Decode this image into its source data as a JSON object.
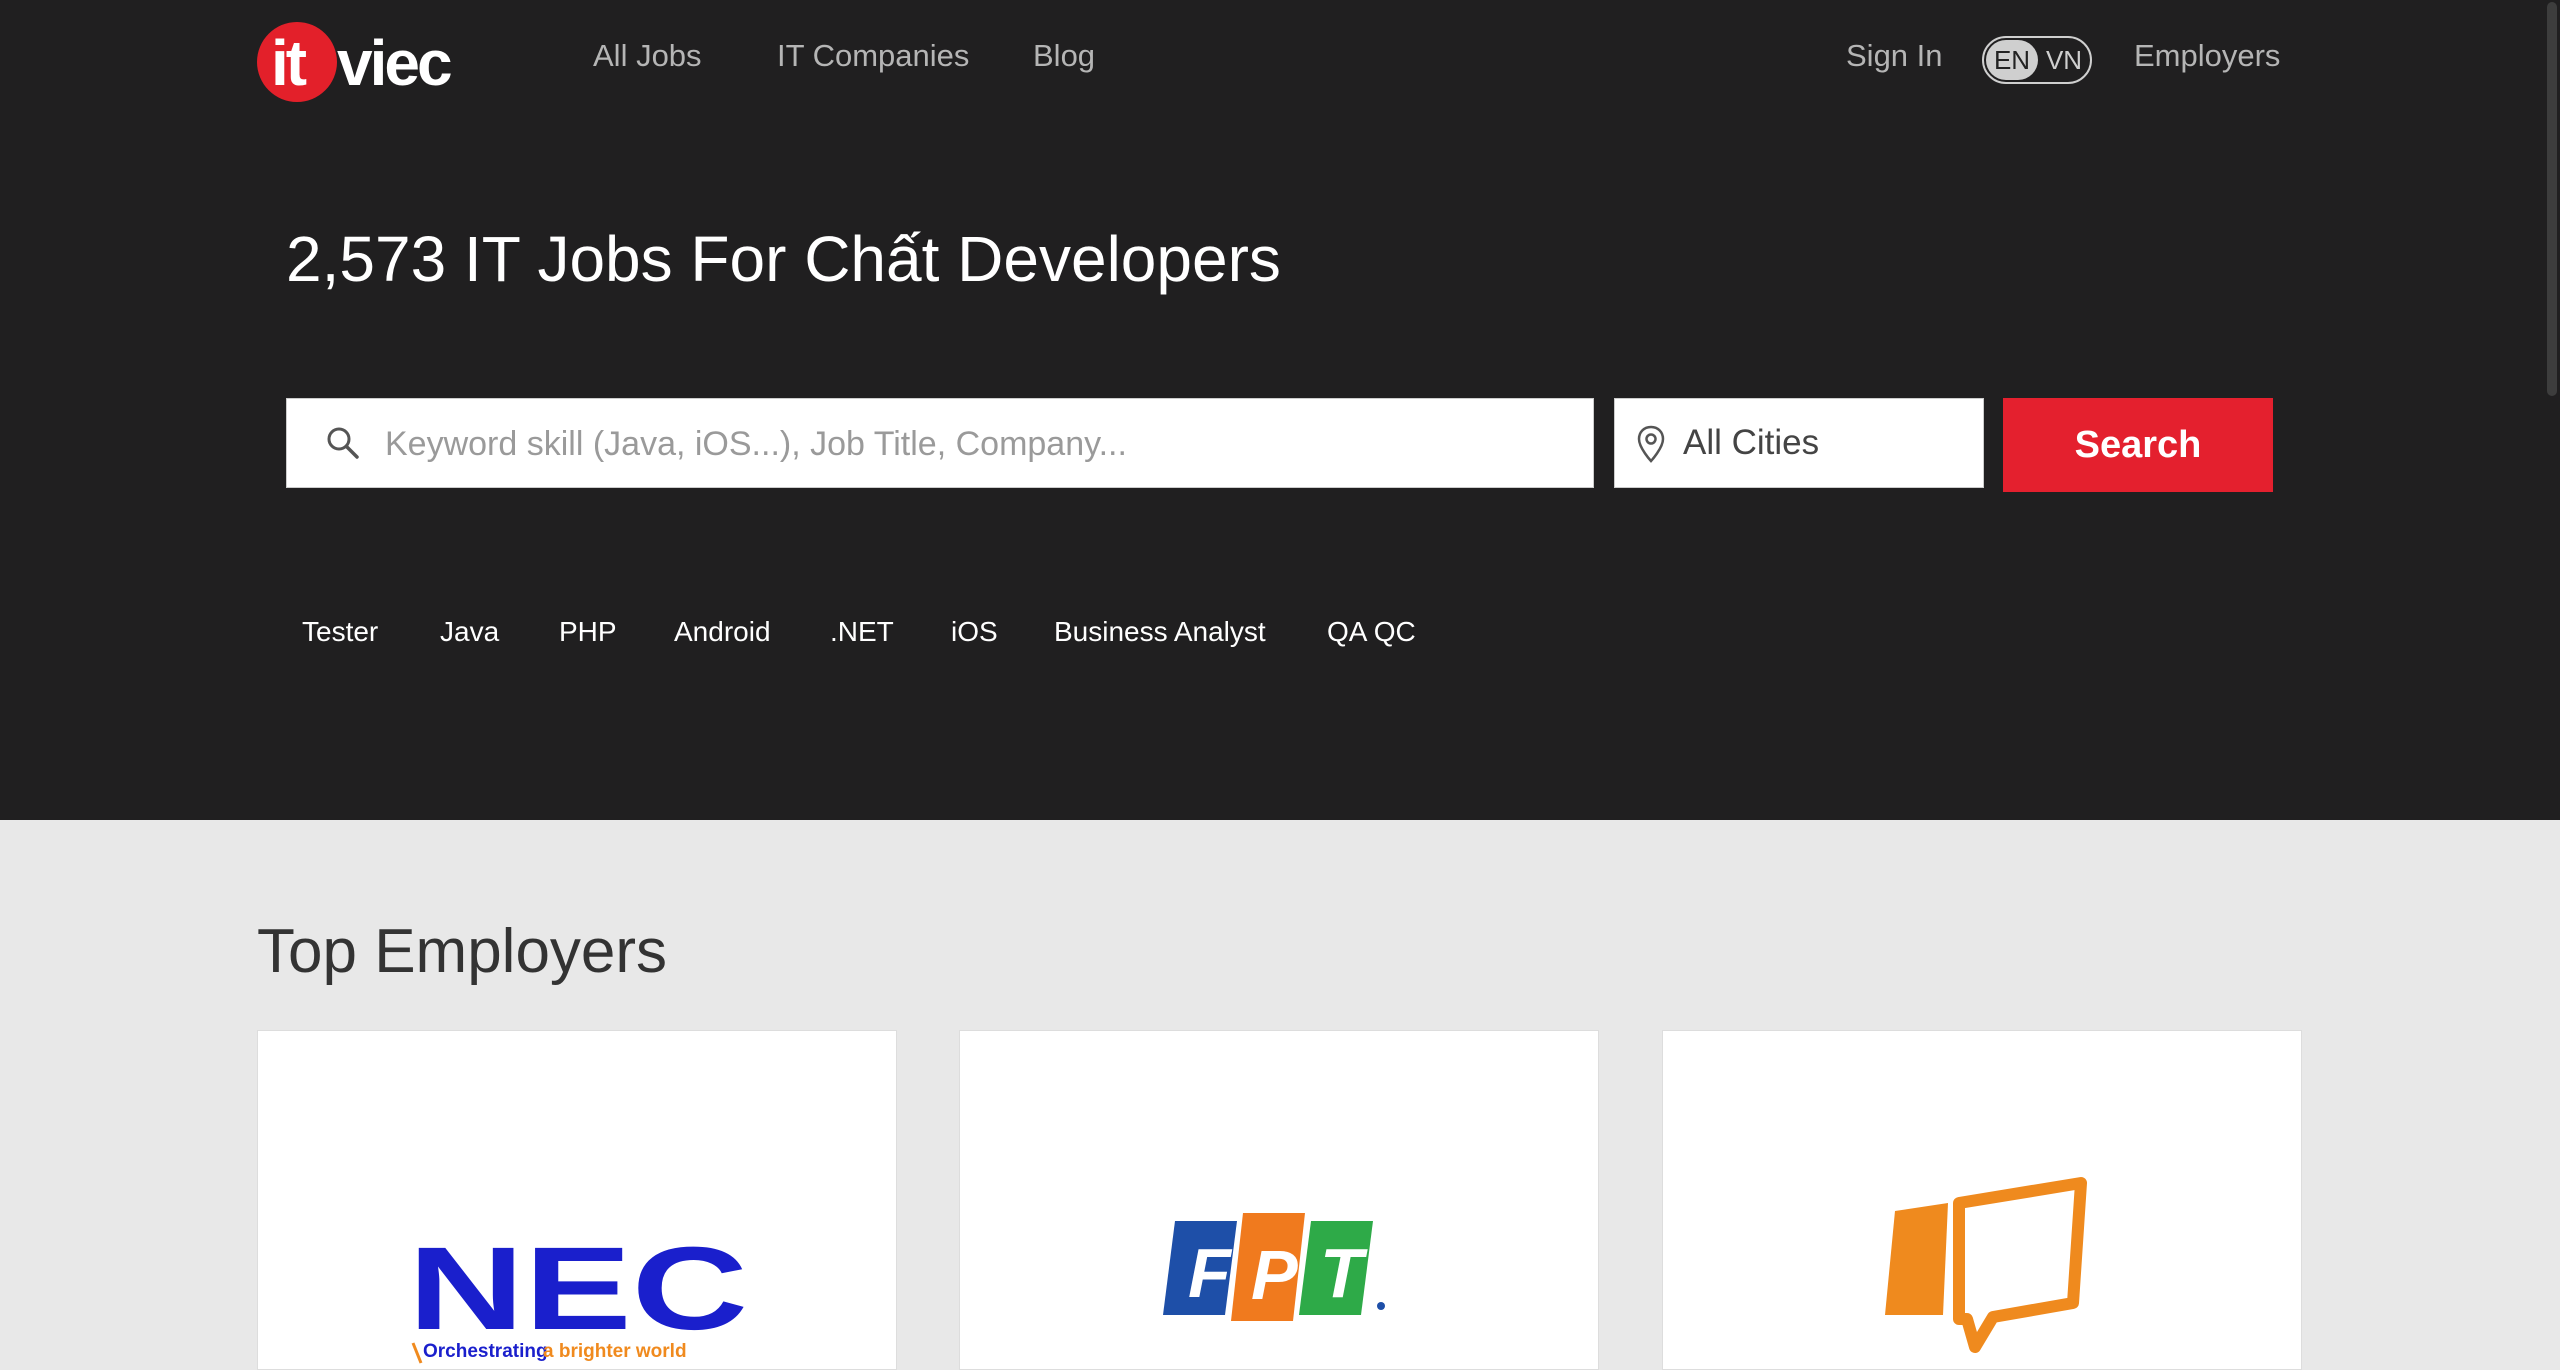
{
  "header": {
    "logo_text_it": "it",
    "logo_text_viec": "viec",
    "nav": [
      "All Jobs",
      "IT Companies",
      "Blog"
    ],
    "sign_in": "Sign In",
    "lang_en": "EN",
    "lang_vn": "VN",
    "employers": "Employers"
  },
  "hero": {
    "title": "2,573 IT Jobs For Chất Developers",
    "search_placeholder": "Keyword skill (Java, iOS...), Job Title, Company...",
    "city": "All Cities",
    "search_button": "Search",
    "tags": [
      "Tester",
      "Java",
      "PHP",
      "Android",
      ".NET",
      "iOS",
      "Business Analyst",
      "QA QC"
    ]
  },
  "top_employers": {
    "title": "Top Employers",
    "logo_texts": {
      "nec": "NEC",
      "nec_tagline": "Orchestrating a brighter world",
      "fpt": [
        "F",
        "P",
        "T"
      ]
    }
  },
  "colors": {
    "hero_bg": "#201f20",
    "accent_red": "#e4202e",
    "page_bg": "#e8e8e8",
    "nec_blue": "#1a1fcc",
    "fpt_blue": "#1e4fa8",
    "fpt_orange": "#f07a1e",
    "fpt_green": "#2eaa48",
    "employer3_orange": "#ef8a1e"
  }
}
